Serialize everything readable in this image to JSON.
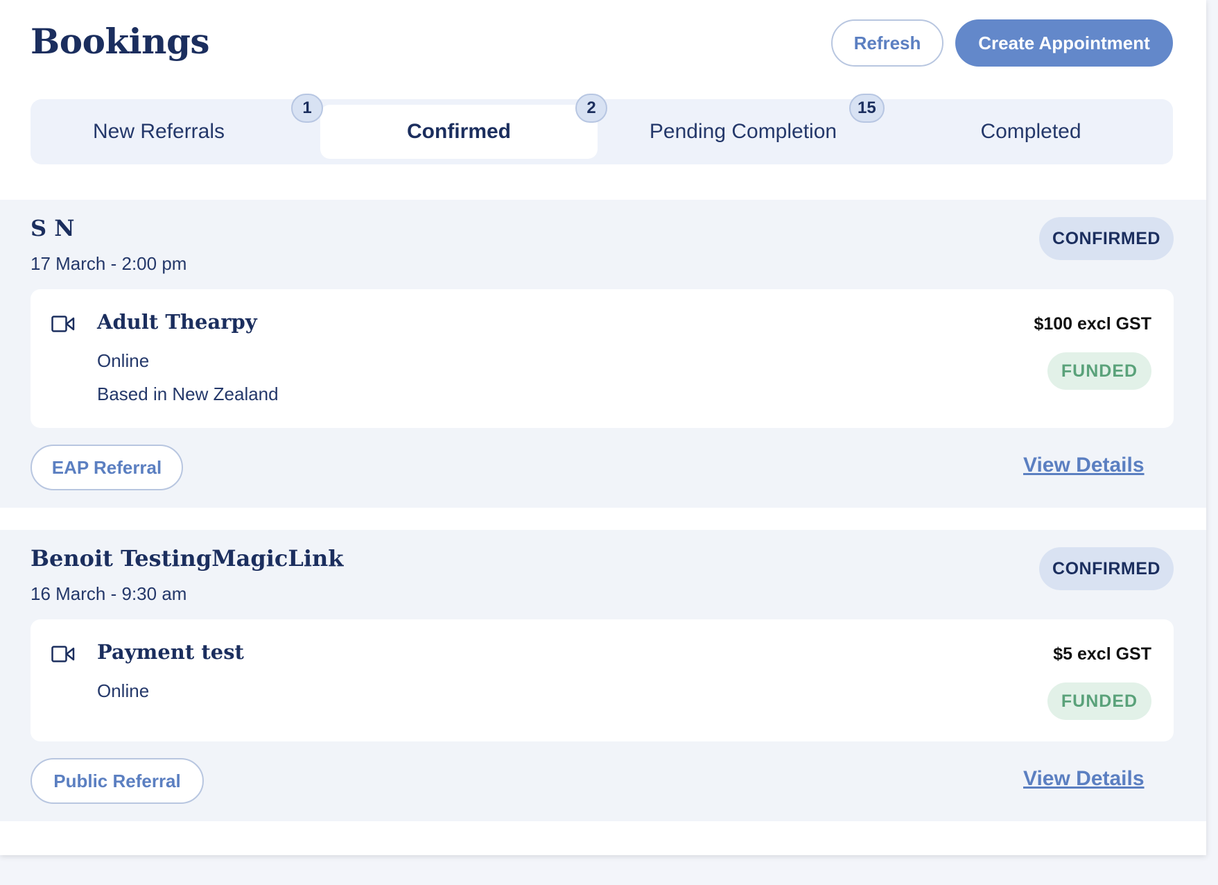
{
  "header": {
    "title": "Bookings",
    "refresh_label": "Refresh",
    "create_label": "Create Appointment"
  },
  "tabs": [
    {
      "label": "New Referrals",
      "count": "1",
      "active": false
    },
    {
      "label": "Confirmed",
      "count": "2",
      "active": true
    },
    {
      "label": "Pending Completion",
      "count": "15",
      "active": false
    },
    {
      "label": "Completed",
      "count": "",
      "active": false
    }
  ],
  "bookings": [
    {
      "client": "S N",
      "datetime": "17 March - 2:00 pm",
      "status": "CONFIRMED",
      "service": {
        "icon": "video-camera-icon",
        "title": "Adult Thearpy",
        "mode": "Online",
        "location": "Based in New Zealand",
        "price": "$100 excl GST",
        "funding": "FUNDED"
      },
      "referral": "EAP Referral",
      "action": "View Details"
    },
    {
      "client": "Benoit TestingMagicLink",
      "datetime": "16 March - 9:30 am",
      "status": "CONFIRMED",
      "service": {
        "icon": "video-camera-icon",
        "title": "Payment test",
        "mode": "Online",
        "price": "$5 excl GST",
        "funding": "FUNDED"
      },
      "referral": "Public Referral",
      "action": "View Details"
    }
  ],
  "colors": {
    "primary": "#6388ca",
    "navy": "#1b2e5e",
    "funded_bg": "#e2f1e8",
    "funded_text": "#5aa27a",
    "status_bg": "#d9e2f2"
  }
}
